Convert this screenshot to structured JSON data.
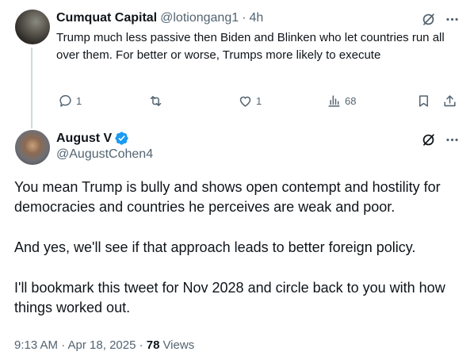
{
  "reply": {
    "author_name": "Cumquat Capital",
    "handle": "@lotiongang1",
    "separator": "·",
    "time": "4h",
    "text": "Trump much less passive then Biden and Blinken who let countries run all over them. For better or worse, Trumps more likely to execute",
    "actions": {
      "reply_count": "1",
      "repost_count": "",
      "like_count": "1",
      "view_count": "68"
    }
  },
  "main": {
    "author_name": "August V",
    "handle": "@AugustCohen4",
    "paragraphs": [
      "You mean Trump is bully and shows open contempt and hostility for democracies and countries he perceives are weak and poor.",
      "And yes, we'll see if that approach leads to better foreign policy.",
      "I'll bookmark this tweet for Nov 2028 and circle back to you with how things worked out."
    ],
    "timestamp": "9:13 AM · Apr 18, 2025 · ",
    "views_count": "78",
    "views_label": "Views"
  },
  "colors": {
    "text": "#0f1419",
    "secondary": "#536471",
    "verified": "#1d9bf0",
    "thread_line": "#cfd9de"
  },
  "icons": [
    "grok-icon",
    "more-icon",
    "reply-icon",
    "repost-icon",
    "like-icon",
    "views-icon",
    "bookmark-icon",
    "share-icon",
    "verified-badge-icon"
  ]
}
